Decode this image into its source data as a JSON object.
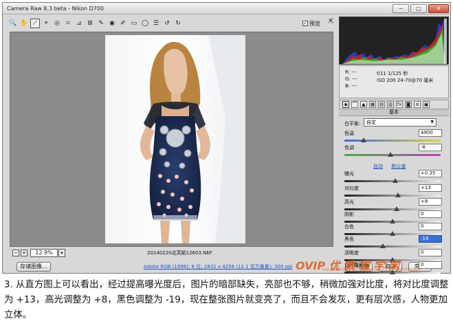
{
  "window": {
    "title": "Camera Raw 8.3 beta - Nikon D700",
    "controls": [
      "─",
      "□",
      "✕"
    ]
  },
  "toolbar": {
    "tools": [
      {
        "icon": "zoom-icon",
        "glyph": "🔍"
      },
      {
        "icon": "hand-icon",
        "glyph": "✋"
      },
      {
        "icon": "white-balance-icon",
        "glyph": "⟋"
      },
      {
        "icon": "color-sampler-icon",
        "glyph": "⌖"
      },
      {
        "icon": "target-adjust-icon",
        "glyph": "◎"
      },
      {
        "icon": "crop-icon",
        "glyph": "⌗"
      },
      {
        "icon": "straighten-icon",
        "glyph": "⊿"
      },
      {
        "icon": "transform-icon",
        "glyph": "⊞"
      },
      {
        "icon": "spot-removal-icon",
        "glyph": "✎"
      },
      {
        "icon": "red-eye-icon",
        "glyph": "◉"
      },
      {
        "icon": "brush-icon",
        "glyph": "✐"
      },
      {
        "icon": "graduated-filter-icon",
        "glyph": "▭"
      },
      {
        "icon": "radial-filter-icon",
        "glyph": "◯"
      },
      {
        "icon": "preferences-icon",
        "glyph": "☰"
      },
      {
        "icon": "rotate-ccw-icon",
        "glyph": "↺"
      },
      {
        "icon": "rotate-cw-icon",
        "glyph": "↻"
      }
    ],
    "preview_label": "预览",
    "preview_checked": "✓"
  },
  "info": {
    "r_label": "R:",
    "r_value": "---",
    "g_label": "G:",
    "g_value": "---",
    "b_label": "B:",
    "b_value": "---",
    "exif_line1": "f/11   1/125 秒",
    "exif_line2": "ISO 200   24-70@70 毫米"
  },
  "panel": {
    "header": "基本",
    "tabs": [
      "◉",
      "⌒",
      "▲",
      "▦",
      "▤",
      "▥",
      "fx",
      "◙",
      "≡",
      "▣"
    ],
    "white_balance_label": "白平衡:",
    "white_balance_value": "自定",
    "auto_label": "自动",
    "default_label": "默认值"
  },
  "sliders": [
    {
      "name": "temperature",
      "label": "色温",
      "value": "4900",
      "pos": 0.2,
      "track": "temp"
    },
    {
      "name": "tint",
      "label": "色调",
      "value": "-8",
      "pos": 0.48,
      "track": "tint"
    },
    {
      "name": "exposure",
      "label": "曝光",
      "value": "+0.35",
      "pos": 0.53,
      "track": "gray"
    },
    {
      "name": "contrast",
      "label": "对比度",
      "value": "+13",
      "pos": 0.56,
      "track": "gray"
    },
    {
      "name": "highlights",
      "label": "高光",
      "value": "+8",
      "pos": 0.54,
      "track": "gray"
    },
    {
      "name": "shadows",
      "label": "阴影",
      "value": "0",
      "pos": 0.5,
      "track": "gray"
    },
    {
      "name": "whites",
      "label": "白色",
      "value": "0",
      "pos": 0.5,
      "track": "gray"
    },
    {
      "name": "blacks",
      "label": "黑色",
      "value": "-19",
      "pos": 0.4,
      "track": "gray",
      "selected": true
    },
    {
      "name": "clarity",
      "label": "清晰度",
      "value": "0",
      "pos": 0.5,
      "track": "gray"
    },
    {
      "name": "vibrance",
      "label": "自然饱和度",
      "value": "0",
      "pos": 0.5,
      "track": "gray"
    }
  ],
  "statusbar": {
    "zoom_minus": "−",
    "zoom_plus": "+",
    "zoom_value": "12.9%",
    "filename": "20140220达芙妮12603.NEF"
  },
  "bottombar": {
    "save_label": "存储图像...",
    "workflow_link": "Adobe RGB (1998); 8 位; 2832 x 4256 (12.1 百万像素); 300 ppi",
    "open_label": "打开图像",
    "cancel_label": "取消",
    "done_label": "完成"
  },
  "watermark": {
    "text": "OVIP 优 教 程 学 网",
    "sub": "THE ORIGINAL VISION INSTITUTE OF PHOTOSHOP"
  },
  "caption": "3. 从直方图上可以看出，经过提高曝光度后，图片的暗部缺失，亮部也不够，稍微加强对比度，将对比度调整为 +13，高光调整为 +8，黑色调整为 -19，现在整张图片就变亮了，而且不会发灰，更有层次感，人物更加立体。",
  "colors": {
    "accent": "#3a70d0",
    "link": "#2050c0",
    "watermark": "#e05a1c"
  }
}
